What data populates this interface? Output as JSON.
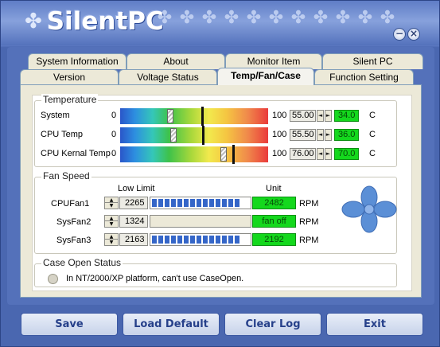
{
  "app": {
    "title": "SilentPC",
    "window_buttons": {
      "minimize": "−",
      "close": "×"
    }
  },
  "tabs": {
    "row1": [
      "System Information",
      "About",
      "Monitor Item",
      "Silent PC"
    ],
    "row2": [
      "Version",
      "Voltage Status",
      "Temp/Fan/Case",
      "Function Setting"
    ],
    "active": "Temp/Fan/Case"
  },
  "temperature": {
    "title": "Temperature",
    "scale_min": "0",
    "scale_max": "100",
    "unit": "C",
    "rows": [
      {
        "label": "System",
        "setting": "55.00",
        "reading": "34.0",
        "reading_pct": 34,
        "setting_pct": 55
      },
      {
        "label": "CPU Temp",
        "setting": "55.50",
        "reading": "36.0",
        "reading_pct": 36,
        "setting_pct": 55.5
      },
      {
        "label": "CPU Kernal Temp",
        "setting": "76.00",
        "reading": "70.0",
        "reading_pct": 70,
        "setting_pct": 76
      }
    ]
  },
  "fan_speed": {
    "title": "Fan Speed",
    "low_limit_label": "Low Limit",
    "unit_label": "Unit",
    "unit": "RPM",
    "rows": [
      {
        "label": "CPUFan1",
        "low_limit": "2265",
        "value": "2482",
        "fill_blocks": 14
      },
      {
        "label": "SysFan2",
        "low_limit": "1324",
        "value": "fan off",
        "fill_blocks": 0
      },
      {
        "label": "SysFan3",
        "low_limit": "2163",
        "value": "2192",
        "fill_blocks": 14
      }
    ]
  },
  "case_open": {
    "title": "Case Open Status",
    "message": "In NT/2000/XP platform, can't use CaseOpen."
  },
  "buttons": {
    "save": "Save",
    "load_default": "Load Default",
    "clear_log": "Clear Log",
    "exit": "Exit"
  },
  "colors": {
    "accent": "#4f6db7",
    "reading_green": "#14d81d",
    "block_blue": "#3566c8"
  }
}
